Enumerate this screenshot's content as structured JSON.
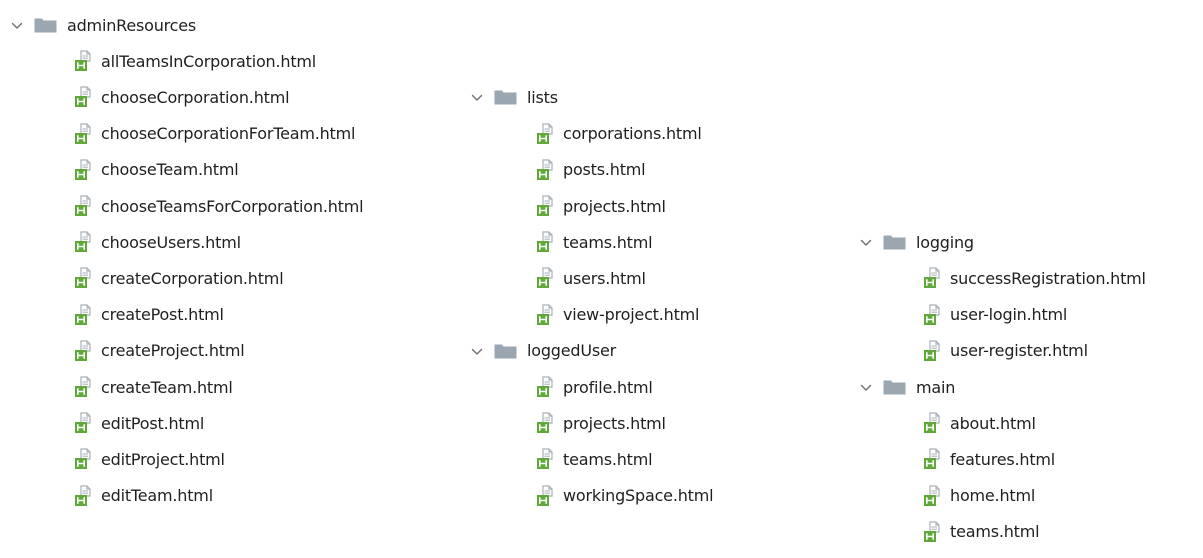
{
  "tree": {
    "columns": [
      {
        "folders": [
          {
            "name": "adminResources",
            "files": [
              "allTeamsInCorporation.html",
              "chooseCorporation.html",
              "chooseCorporationForTeam.html",
              "chooseTeam.html",
              "chooseTeamsForCorporation.html",
              "chooseUsers.html",
              "createCorporation.html",
              "createPost.html",
              "createProject.html",
              "createTeam.html",
              "editPost.html",
              "editProject.html",
              "editTeam.html"
            ]
          }
        ]
      },
      {
        "folders": [
          {
            "name": "lists",
            "files": [
              "corporations.html",
              "posts.html",
              "projects.html",
              "teams.html",
              "users.html",
              "view-project.html"
            ]
          },
          {
            "name": "loggedUser",
            "files": [
              "profile.html",
              "projects.html",
              "teams.html",
              "workingSpace.html"
            ]
          }
        ]
      },
      {
        "folders": [
          {
            "name": "logging",
            "files": [
              "successRegistration.html",
              "user-login.html",
              "user-register.html"
            ]
          },
          {
            "name": "main",
            "files": [
              "about.html",
              "features.html",
              "home.html",
              "teams.html"
            ]
          }
        ]
      }
    ]
  },
  "colors": {
    "text": "#1f1f1f",
    "folder": "#9aa7b0",
    "file_icon_green": "#5fa83a",
    "file_icon_gray": "#a8b1b7",
    "chevron": "#6e6e6e"
  },
  "icons": {
    "expand": "chevron-down-icon",
    "folder": "folder-icon",
    "file": "html-file-icon"
  }
}
